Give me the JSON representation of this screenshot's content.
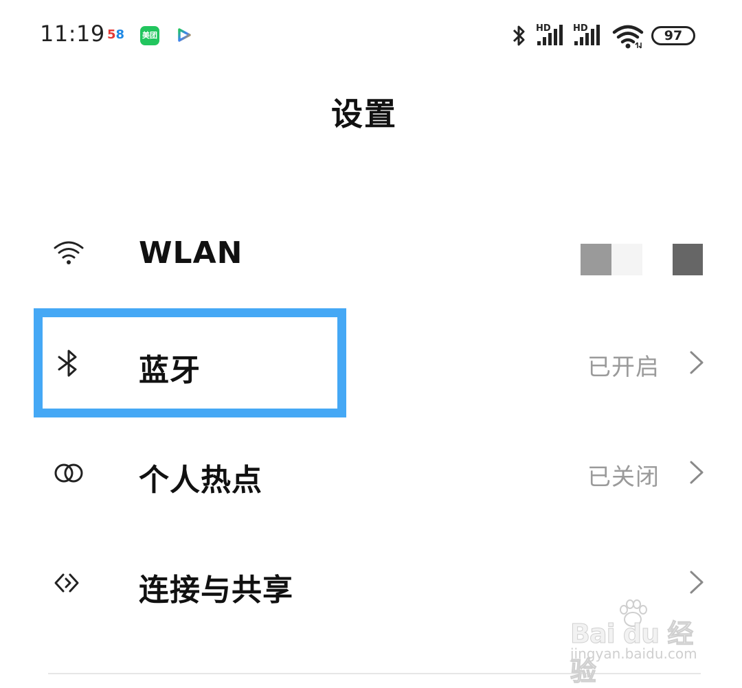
{
  "status_bar": {
    "time": "11:19",
    "notif_58": "58",
    "notif_meituan": "美团",
    "battery": "97",
    "signal_1_label": "HD",
    "signal_2_label": "HD"
  },
  "title": "设置",
  "settings": {
    "wlan": {
      "label": "WLAN",
      "icon": "wifi-icon"
    },
    "bluetooth": {
      "label": "蓝牙",
      "status": "已开启",
      "icon": "bluetooth-icon"
    },
    "hotspot": {
      "label": "个人热点",
      "status": "已关闭",
      "icon": "hotspot-icon"
    },
    "sharing": {
      "label": "连接与共享",
      "icon": "connection-share-icon"
    }
  },
  "highlight_color": "#45a8f5",
  "watermark": {
    "logo": "Bai du 经验",
    "url": "jingyan.baidu.com"
  }
}
